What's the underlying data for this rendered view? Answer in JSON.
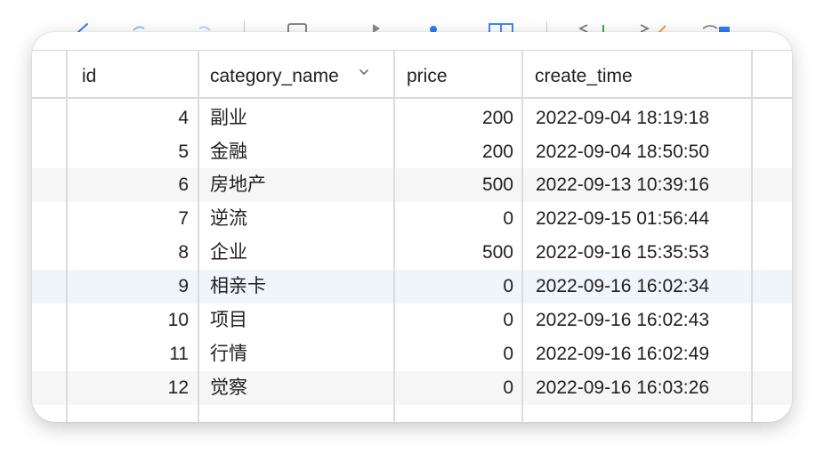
{
  "table": {
    "columns": [
      {
        "label": "id",
        "key": "id"
      },
      {
        "label": "category_name",
        "key": "category_name"
      },
      {
        "label": "price",
        "key": "price"
      },
      {
        "label": "create_time",
        "key": "create_time"
      }
    ],
    "rows": [
      {
        "id": "4",
        "category_name": "副业",
        "price": "200",
        "create_time": "2022-09-04 18:19:18"
      },
      {
        "id": "5",
        "category_name": "金融",
        "price": "200",
        "create_time": "2022-09-04 18:50:50"
      },
      {
        "id": "6",
        "category_name": "房地产",
        "price": "500",
        "create_time": "2022-09-13 10:39:16"
      },
      {
        "id": "7",
        "category_name": "逆流",
        "price": "0",
        "create_time": "2022-09-15 01:56:44"
      },
      {
        "id": "8",
        "category_name": "企业",
        "price": "500",
        "create_time": "2022-09-16 15:35:53"
      },
      {
        "id": "9",
        "category_name": "相亲卡",
        "price": "0",
        "create_time": "2022-09-16 16:02:34"
      },
      {
        "id": "10",
        "category_name": "项目",
        "price": "0",
        "create_time": "2022-09-16 16:02:43"
      },
      {
        "id": "11",
        "category_name": "行情",
        "price": "0",
        "create_time": "2022-09-16 16:02:49"
      },
      {
        "id": "12",
        "category_name": "觉察",
        "price": "0",
        "create_time": "2022-09-16 16:03:26"
      }
    ],
    "selected_row_index": 5,
    "row_stripe_indices": [
      2,
      8
    ],
    "sort_icon": "chevron-down-icon"
  },
  "colors": {
    "header_text": "#1f1f1f",
    "cell_text": "#1f1f1f",
    "stripe": "#f6f6f6",
    "selected": "#f0f4fb",
    "grid_line": "#dcdcdc",
    "toolbar_accent": "#2f7cf6"
  }
}
